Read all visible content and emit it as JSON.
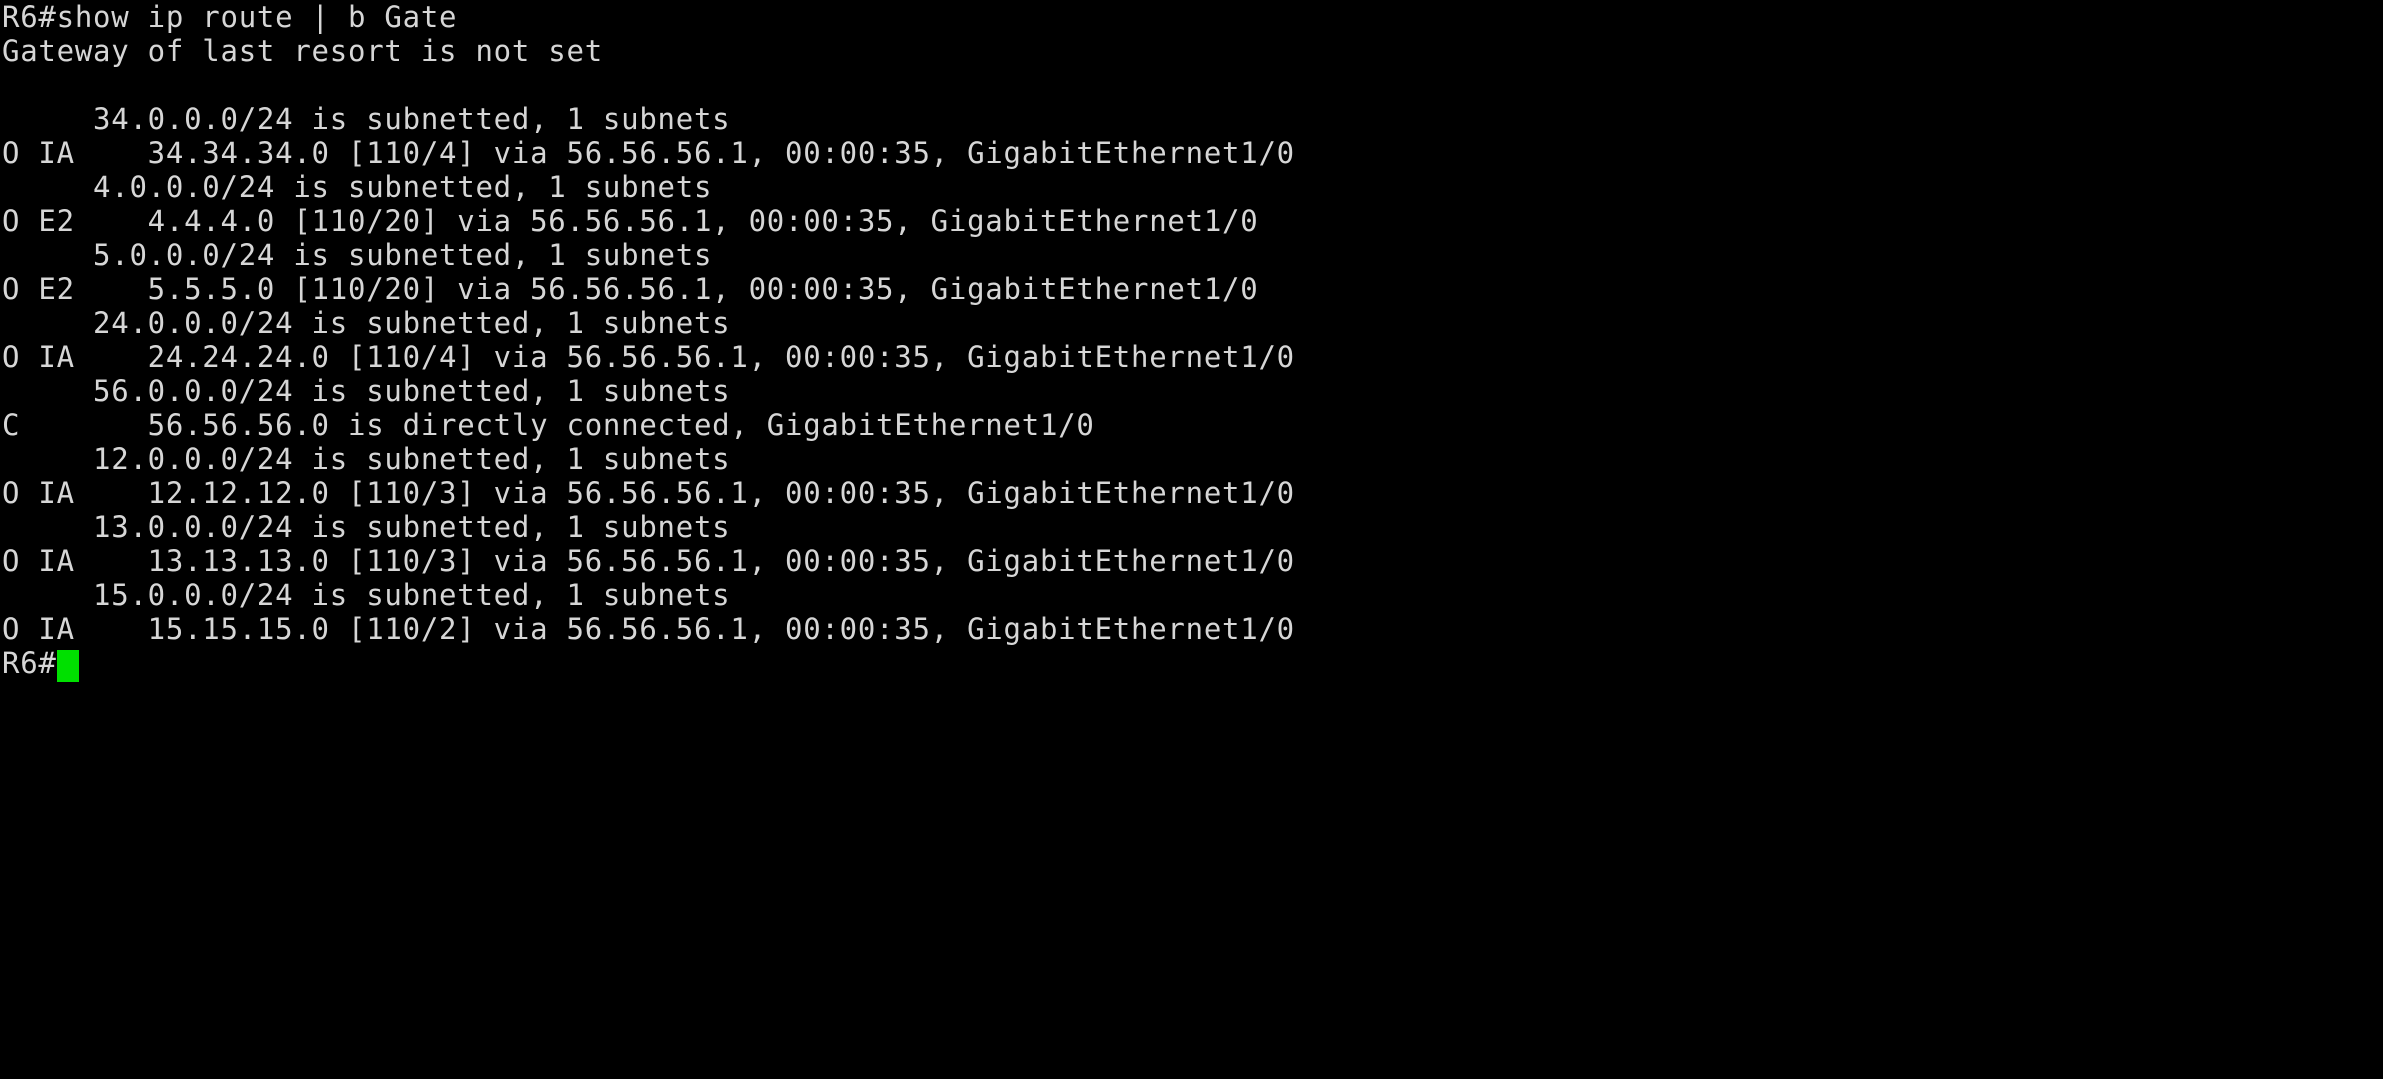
{
  "terminal": {
    "app": "router-console",
    "background_color": "#000000",
    "text_color": "#d6d6d6",
    "cursor_color": "#00e000",
    "hostname": "R6",
    "prompt_symbol": "#",
    "command_line": "R6#show ip route | b Gate",
    "gateway_line": "Gateway of last resort is not set",
    "blank_line": "",
    "prompt_text": "R6#",
    "lines": [
      "R6#show ip route | b Gate",
      "Gateway of last resort is not set",
      "",
      "     34.0.0.0/24 is subnetted, 1 subnets",
      "O IA    34.34.34.0 [110/4] via 56.56.56.1, 00:00:35, GigabitEthernet1/0",
      "     4.0.0.0/24 is subnetted, 1 subnets",
      "O E2    4.4.4.0 [110/20] via 56.56.56.1, 00:00:35, GigabitEthernet1/0",
      "     5.0.0.0/24 is subnetted, 1 subnets",
      "O E2    5.5.5.0 [110/20] via 56.56.56.1, 00:00:35, GigabitEthernet1/0",
      "     24.0.0.0/24 is subnetted, 1 subnets",
      "O IA    24.24.24.0 [110/4] via 56.56.56.1, 00:00:35, GigabitEthernet1/0",
      "     56.0.0.0/24 is subnetted, 1 subnets",
      "C       56.56.56.0 is directly connected, GigabitEthernet1/0",
      "     12.0.0.0/24 is subnetted, 1 subnets",
      "O IA    12.12.12.0 [110/3] via 56.56.56.1, 00:00:35, GigabitEthernet1/0",
      "     13.0.0.0/24 is subnetted, 1 subnets",
      "O IA    13.13.13.0 [110/3] via 56.56.56.1, 00:00:35, GigabitEthernet1/0",
      "     15.0.0.0/24 is subnetted, 1 subnets",
      "O IA    15.15.15.0 [110/2] via 56.56.56.1, 00:00:35, GigabitEthernet1/0"
    ],
    "routing_table": [
      {
        "subnet_header": "     34.0.0.0/24 is subnetted, 1 subnets",
        "network": "34.0.0.0/24",
        "subnets_count": "1",
        "code": "O IA",
        "route_line": "O IA    34.34.34.0 [110/4] via 56.56.56.1, 00:00:35, GigabitEthernet1/0",
        "prefix": "34.34.34.0",
        "metric": "[110/4]",
        "next_hop": "56.56.56.1",
        "uptime": "00:00:35",
        "interface": "GigabitEthernet1/0"
      },
      {
        "subnet_header": "     4.0.0.0/24 is subnetted, 1 subnets",
        "network": "4.0.0.0/24",
        "subnets_count": "1",
        "code": "O E2",
        "route_line": "O E2    4.4.4.0 [110/20] via 56.56.56.1, 00:00:35, GigabitEthernet1/0",
        "prefix": "4.4.4.0",
        "metric": "[110/20]",
        "next_hop": "56.56.56.1",
        "uptime": "00:00:35",
        "interface": "GigabitEthernet1/0"
      },
      {
        "subnet_header": "     5.0.0.0/24 is subnetted, 1 subnets",
        "network": "5.0.0.0/24",
        "subnets_count": "1",
        "code": "O E2",
        "route_line": "O E2    5.5.5.0 [110/20] via 56.56.56.1, 00:00:35, GigabitEthernet1/0",
        "prefix": "5.5.5.0",
        "metric": "[110/20]",
        "next_hop": "56.56.56.1",
        "uptime": "00:00:35",
        "interface": "GigabitEthernet1/0"
      },
      {
        "subnet_header": "     24.0.0.0/24 is subnetted, 1 subnets",
        "network": "24.0.0.0/24",
        "subnets_count": "1",
        "code": "O IA",
        "route_line": "O IA    24.24.24.0 [110/4] via 56.56.56.1, 00:00:35, GigabitEthernet1/0",
        "prefix": "24.24.24.0",
        "metric": "[110/4]",
        "next_hop": "56.56.56.1",
        "uptime": "00:00:35",
        "interface": "GigabitEthernet1/0"
      },
      {
        "subnet_header": "     56.0.0.0/24 is subnetted, 1 subnets",
        "network": "56.0.0.0/24",
        "subnets_count": "1",
        "code": "C",
        "route_line": "C       56.56.56.0 is directly connected, GigabitEthernet1/0",
        "prefix": "56.56.56.0",
        "metric": "",
        "next_hop": "",
        "uptime": "",
        "interface": "GigabitEthernet1/0"
      },
      {
        "subnet_header": "     12.0.0.0/24 is subnetted, 1 subnets",
        "network": "12.0.0.0/24",
        "subnets_count": "1",
        "code": "O IA",
        "route_line": "O IA    12.12.12.0 [110/3] via 56.56.56.1, 00:00:35, GigabitEthernet1/0",
        "prefix": "12.12.12.0",
        "metric": "[110/3]",
        "next_hop": "56.56.56.1",
        "uptime": "00:00:35",
        "interface": "GigabitEthernet1/0"
      },
      {
        "subnet_header": "     13.0.0.0/24 is subnetted, 1 subnets",
        "network": "13.0.0.0/24",
        "subnets_count": "1",
        "code": "O IA",
        "route_line": "O IA    13.13.13.0 [110/3] via 56.56.56.1, 00:00:35, GigabitEthernet1/0",
        "prefix": "13.13.13.0",
        "metric": "[110/3]",
        "next_hop": "56.56.56.1",
        "uptime": "00:00:35",
        "interface": "GigabitEthernet1/0"
      },
      {
        "subnet_header": "     15.0.0.0/24 is subnetted, 1 subnets",
        "network": "15.0.0.0/24",
        "subnets_count": "1",
        "code": "O IA",
        "route_line": "O IA    15.15.15.0 [110/2] via 56.56.56.1, 00:00:35, GigabitEthernet1/0",
        "prefix": "15.15.15.0",
        "metric": "[110/2]",
        "next_hop": "56.56.56.1",
        "uptime": "00:00:35",
        "interface": "GigabitEthernet1/0"
      }
    ]
  }
}
